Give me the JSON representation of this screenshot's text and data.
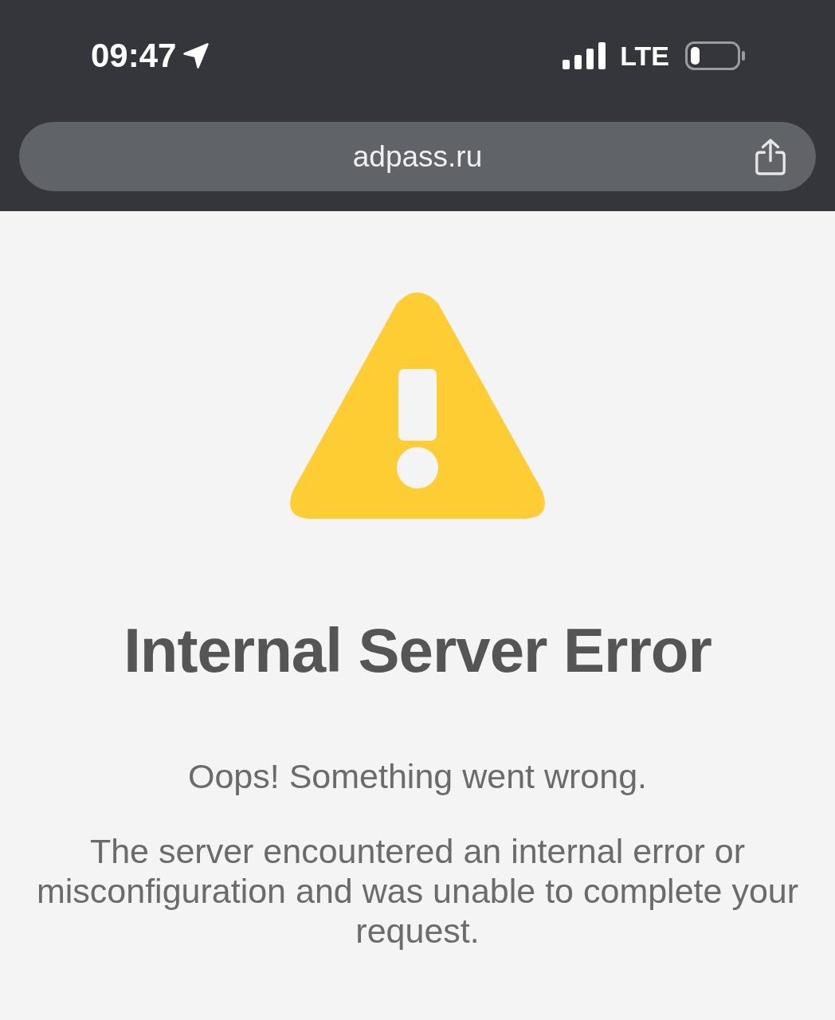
{
  "status_bar": {
    "time": "09:47",
    "network": "LTE"
  },
  "address_bar": {
    "url": "adpass.ru"
  },
  "page": {
    "title": "Internal Server Error",
    "subtitle": "Oops! Something went wrong.",
    "message": "The server encountered an internal error or misconfiguration and was unable to complete your request."
  }
}
